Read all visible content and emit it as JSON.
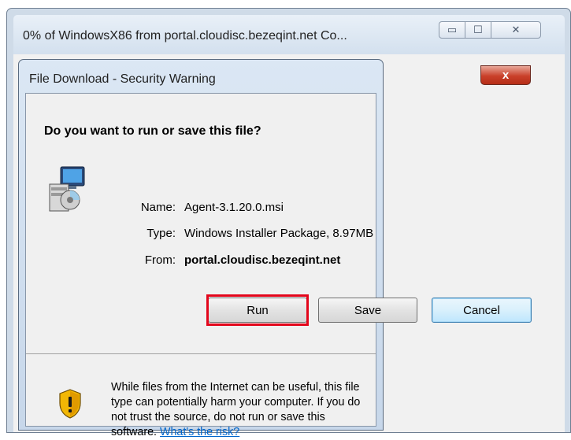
{
  "background_window": {
    "title": "0% of WindowsX86 from portal.cloudisc.bezeqint.net Co...",
    "controls": {
      "minimize": "▭",
      "maximize": "☐",
      "close": "✕"
    }
  },
  "dialog": {
    "title": "File Download - Security Warning",
    "close_label": "x",
    "question": "Do you want to run or save this file?",
    "file": {
      "name_label": "Name:",
      "name_value": "Agent-3.1.20.0.msi",
      "type_label": "Type:",
      "type_value": "Windows Installer Package, 8.97MB",
      "from_label": "From:",
      "from_value": "portal.cloudisc.bezeqint.net"
    },
    "buttons": {
      "run": "Run",
      "save": "Save",
      "cancel": "Cancel"
    },
    "warning": {
      "text": "While files from the Internet can be useful, this file type can potentially harm your computer. If you do not trust the source, do not run or save this software. ",
      "link": "What's the risk?"
    }
  },
  "icons": [
    "installer-package-icon",
    "warning-shield-icon",
    "close-icon",
    "minimize-icon",
    "maximize-icon"
  ],
  "colors": {
    "highlight": "#e3061b",
    "link": "#0066cc",
    "close_button": "#c9402a"
  }
}
